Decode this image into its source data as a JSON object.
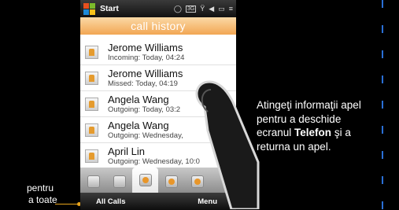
{
  "statusbar": {
    "start_label": "Start",
    "icons": [
      "chat-icon",
      "3g-icon",
      "signal-icon",
      "volume-icon",
      "battery-icon",
      "menu-icon"
    ],
    "net_text": "3G"
  },
  "header": {
    "title": "call history"
  },
  "calls": [
    {
      "name": "Jerome Williams",
      "detail": "Incoming: Today, 04:24"
    },
    {
      "name": "Jerome Williams",
      "detail": "Missed: Today, 04:19"
    },
    {
      "name": "Angela Wang",
      "detail": "Outgoing: Today, 03:2"
    },
    {
      "name": "Angela Wang",
      "detail": "Outgoing: Wednesday,"
    },
    {
      "name": "April Lin",
      "detail": "Outgoing: Wednesday, 10:0"
    }
  ],
  "softkeys": {
    "left": "All Calls",
    "right": "Menu"
  },
  "left_note": {
    "line1": "pentru",
    "line2": "a toate"
  },
  "right_note": {
    "text1": "Atingeţi informaţii apel pentru a deschide ecranul",
    "bold": "Telefon",
    "text2": "şi a returna un apel."
  },
  "colors": {
    "accent_orange": "#f2a653",
    "dash_blue": "#2a6fd6"
  }
}
